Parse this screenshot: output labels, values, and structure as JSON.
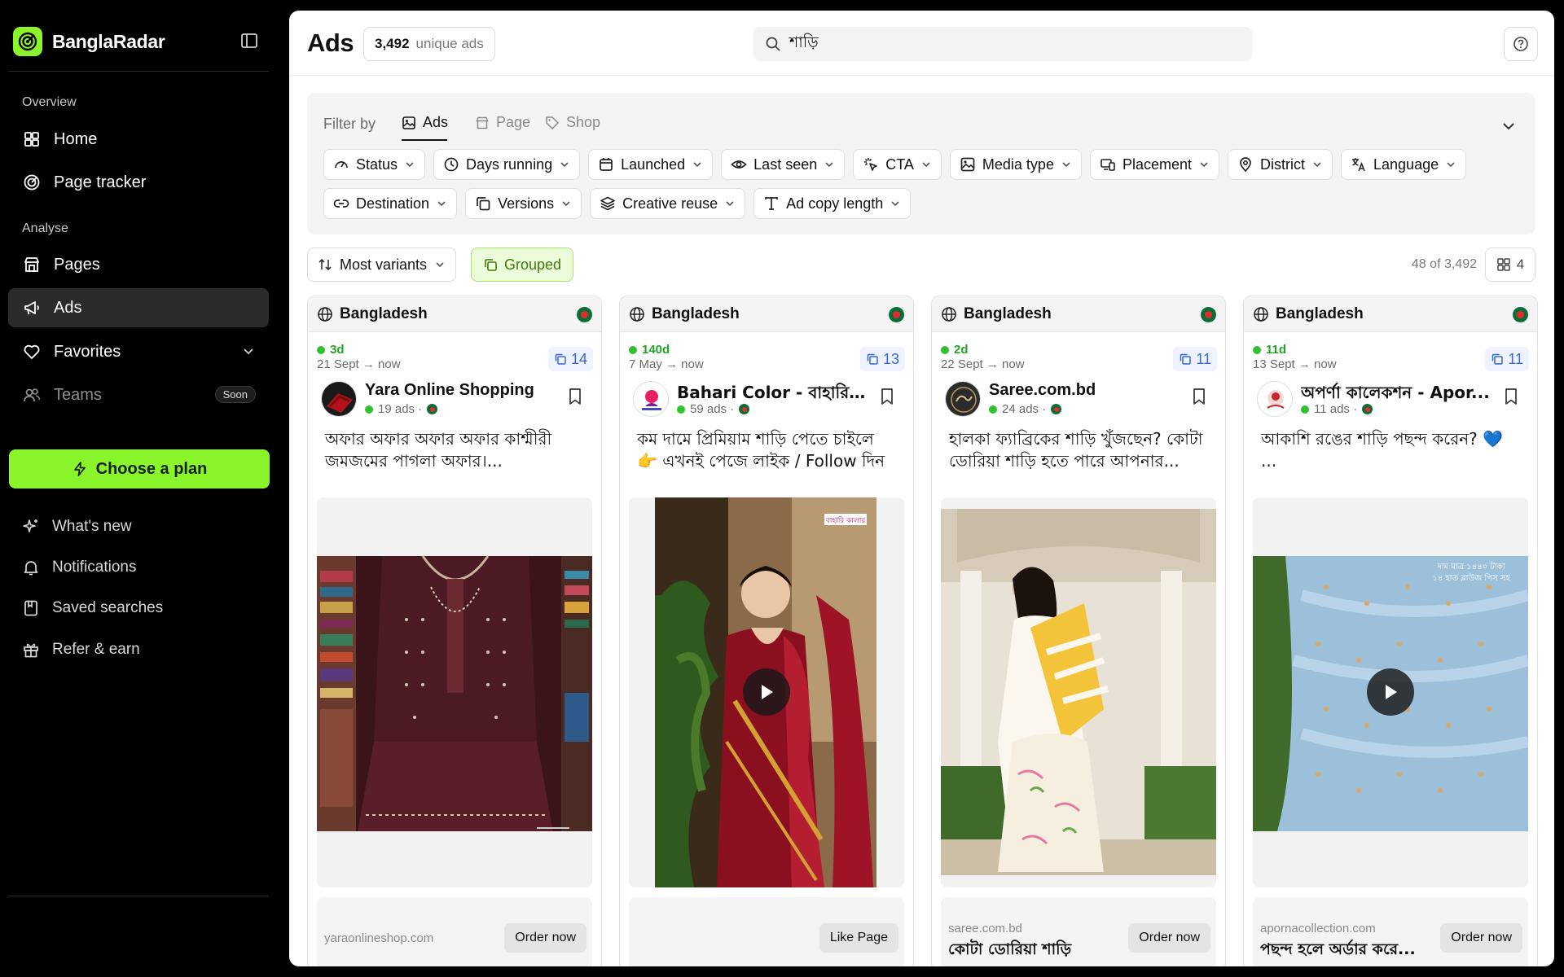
{
  "brand": {
    "name": "BanglaRadar"
  },
  "sidebar": {
    "overview_label": "Overview",
    "home": "Home",
    "page_tracker": "Page tracker",
    "analyse_label": "Analyse",
    "pages": "Pages",
    "ads": "Ads",
    "favorites": "Favorites",
    "teams": "Teams",
    "teams_badge": "Soon",
    "choose_plan": "Choose a plan",
    "whats_new": "What's new",
    "notifications": "Notifications",
    "saved_searches": "Saved searches",
    "refer_earn": "Refer & earn"
  },
  "header": {
    "title": "Ads",
    "count": "3,492",
    "count_label": "unique ads",
    "search_value": "শাড়ি"
  },
  "filters": {
    "filter_by": "Filter by",
    "tabs": [
      "Ads",
      "Page",
      "Shop"
    ],
    "row1": [
      "Status",
      "Days running",
      "Launched",
      "Last seen",
      "CTA",
      "Media type",
      "Placement",
      "District",
      "Language"
    ],
    "row2": [
      "Destination",
      "Versions",
      "Creative reuse",
      "Ad copy length"
    ]
  },
  "sort": {
    "label": "Most variants",
    "grouped": "Grouped",
    "results": "48 of 3,492",
    "columns": "4"
  },
  "cards": [
    {
      "country": "Bangladesh",
      "days": "3d",
      "range": "21 Sept → now",
      "variants": "14",
      "page_name": "Yara Online Shopping",
      "page_ads": "19 ads ·",
      "copy": "অফার অফার অফার অফার কাশ্মীরী জমজমের পাগলা অফার।...",
      "domain": "yaraonlineshop.com",
      "cta_title": "",
      "cta": "Order now"
    },
    {
      "country": "Bangladesh",
      "days": "140d",
      "range": "7 May → now",
      "variants": "13",
      "page_name": "Bahari Color - বাহারি কা...",
      "page_ads": "59 ads ·",
      "copy": "কম দামে প্রিমিয়াম শাড়ি পেতে চাইলে 👉 এখনই পেজে লাইক / Follow দিন",
      "domain": "",
      "cta_title": "",
      "cta": "Like Page"
    },
    {
      "country": "Bangladesh",
      "days": "2d",
      "range": "22 Sept → now",
      "variants": "11",
      "page_name": "Saree.com.bd",
      "page_ads": "24 ads ·",
      "copy": "হালকা ফ্যাব্রিকের শাড়ি খুঁজছেন? কোটা ডোরিয়া শাড়ি হতে পারে আপনার...",
      "domain": "saree.com.bd",
      "cta_title": "কোটা ডোরিয়া শাড়ি",
      "cta": "Order now"
    },
    {
      "country": "Bangladesh",
      "days": "11d",
      "range": "13 Sept → now",
      "variants": "11",
      "page_name": "অপর্ণা কালেকশন - Apor...",
      "page_ads": "11 ads ·",
      "copy": "আকাশি রঙের শাড়ি পছন্দ করেন? 💙 ...",
      "domain": "apornacollection.com",
      "cta_title": "পছন্দ হলে অর্ডার করে...",
      "cta": "Order now"
    }
  ],
  "media_overlays": {
    "card2_logo": "বাহারি কালার",
    "card4_price_line1": "দাম মাত্র ১৪৪০ টাকা",
    "card4_price_line2": "১৪ হাত ব্লাউজ পিস সহ"
  },
  "colors": {
    "accent": "#8BF52C",
    "active_green": "#2ec22e",
    "variant_blue": "#3a66d6"
  }
}
